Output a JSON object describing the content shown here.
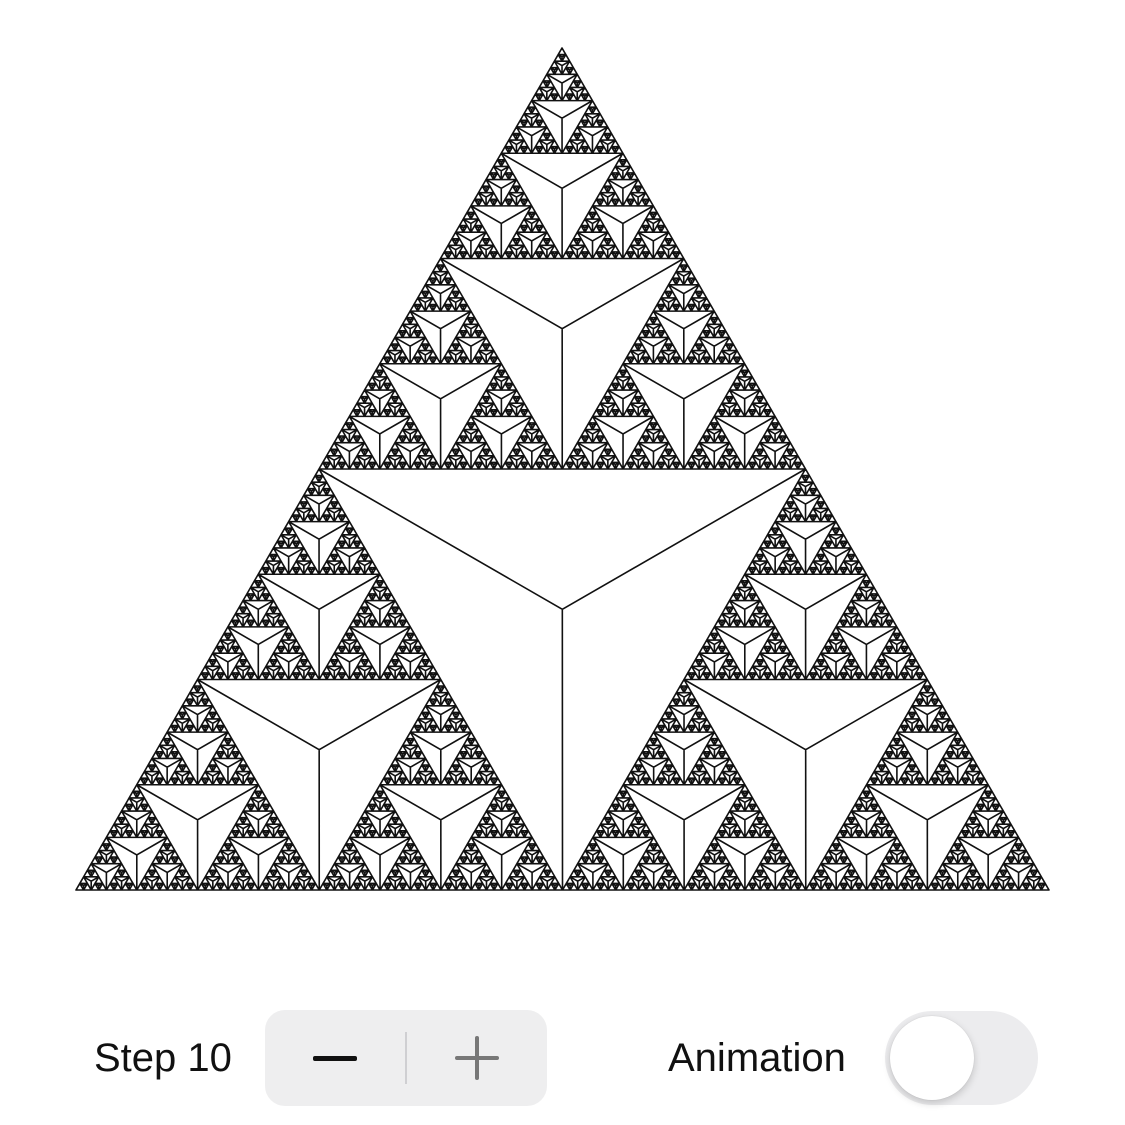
{
  "fractal": {
    "name": "Sierpinski triangle",
    "depth": 7,
    "line_color": "#111111",
    "background_color": "#ffffff"
  },
  "controls": {
    "step_label": "Step 10",
    "step_value": 10,
    "minus_icon": "minus-icon",
    "plus_icon": "plus-icon",
    "animation_label": "Animation",
    "animation_enabled": false
  }
}
